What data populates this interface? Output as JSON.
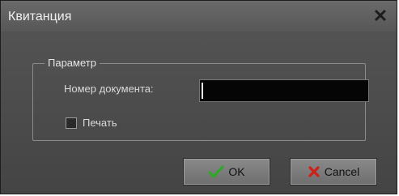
{
  "window": {
    "title": "Квитанция"
  },
  "group": {
    "legend": "Параметр",
    "doc_number_label": "Номер документа:",
    "doc_number_value": "",
    "print_label": "Печать",
    "print_checked": false
  },
  "buttons": {
    "ok_label": "OK",
    "cancel_label": "Cancel"
  },
  "icons": {
    "ok": "checkmark-icon",
    "cancel": "cross-icon",
    "close": "close-icon"
  },
  "colors": {
    "ok_icon": "#2fa82a",
    "cancel_icon": "#d0201a"
  }
}
